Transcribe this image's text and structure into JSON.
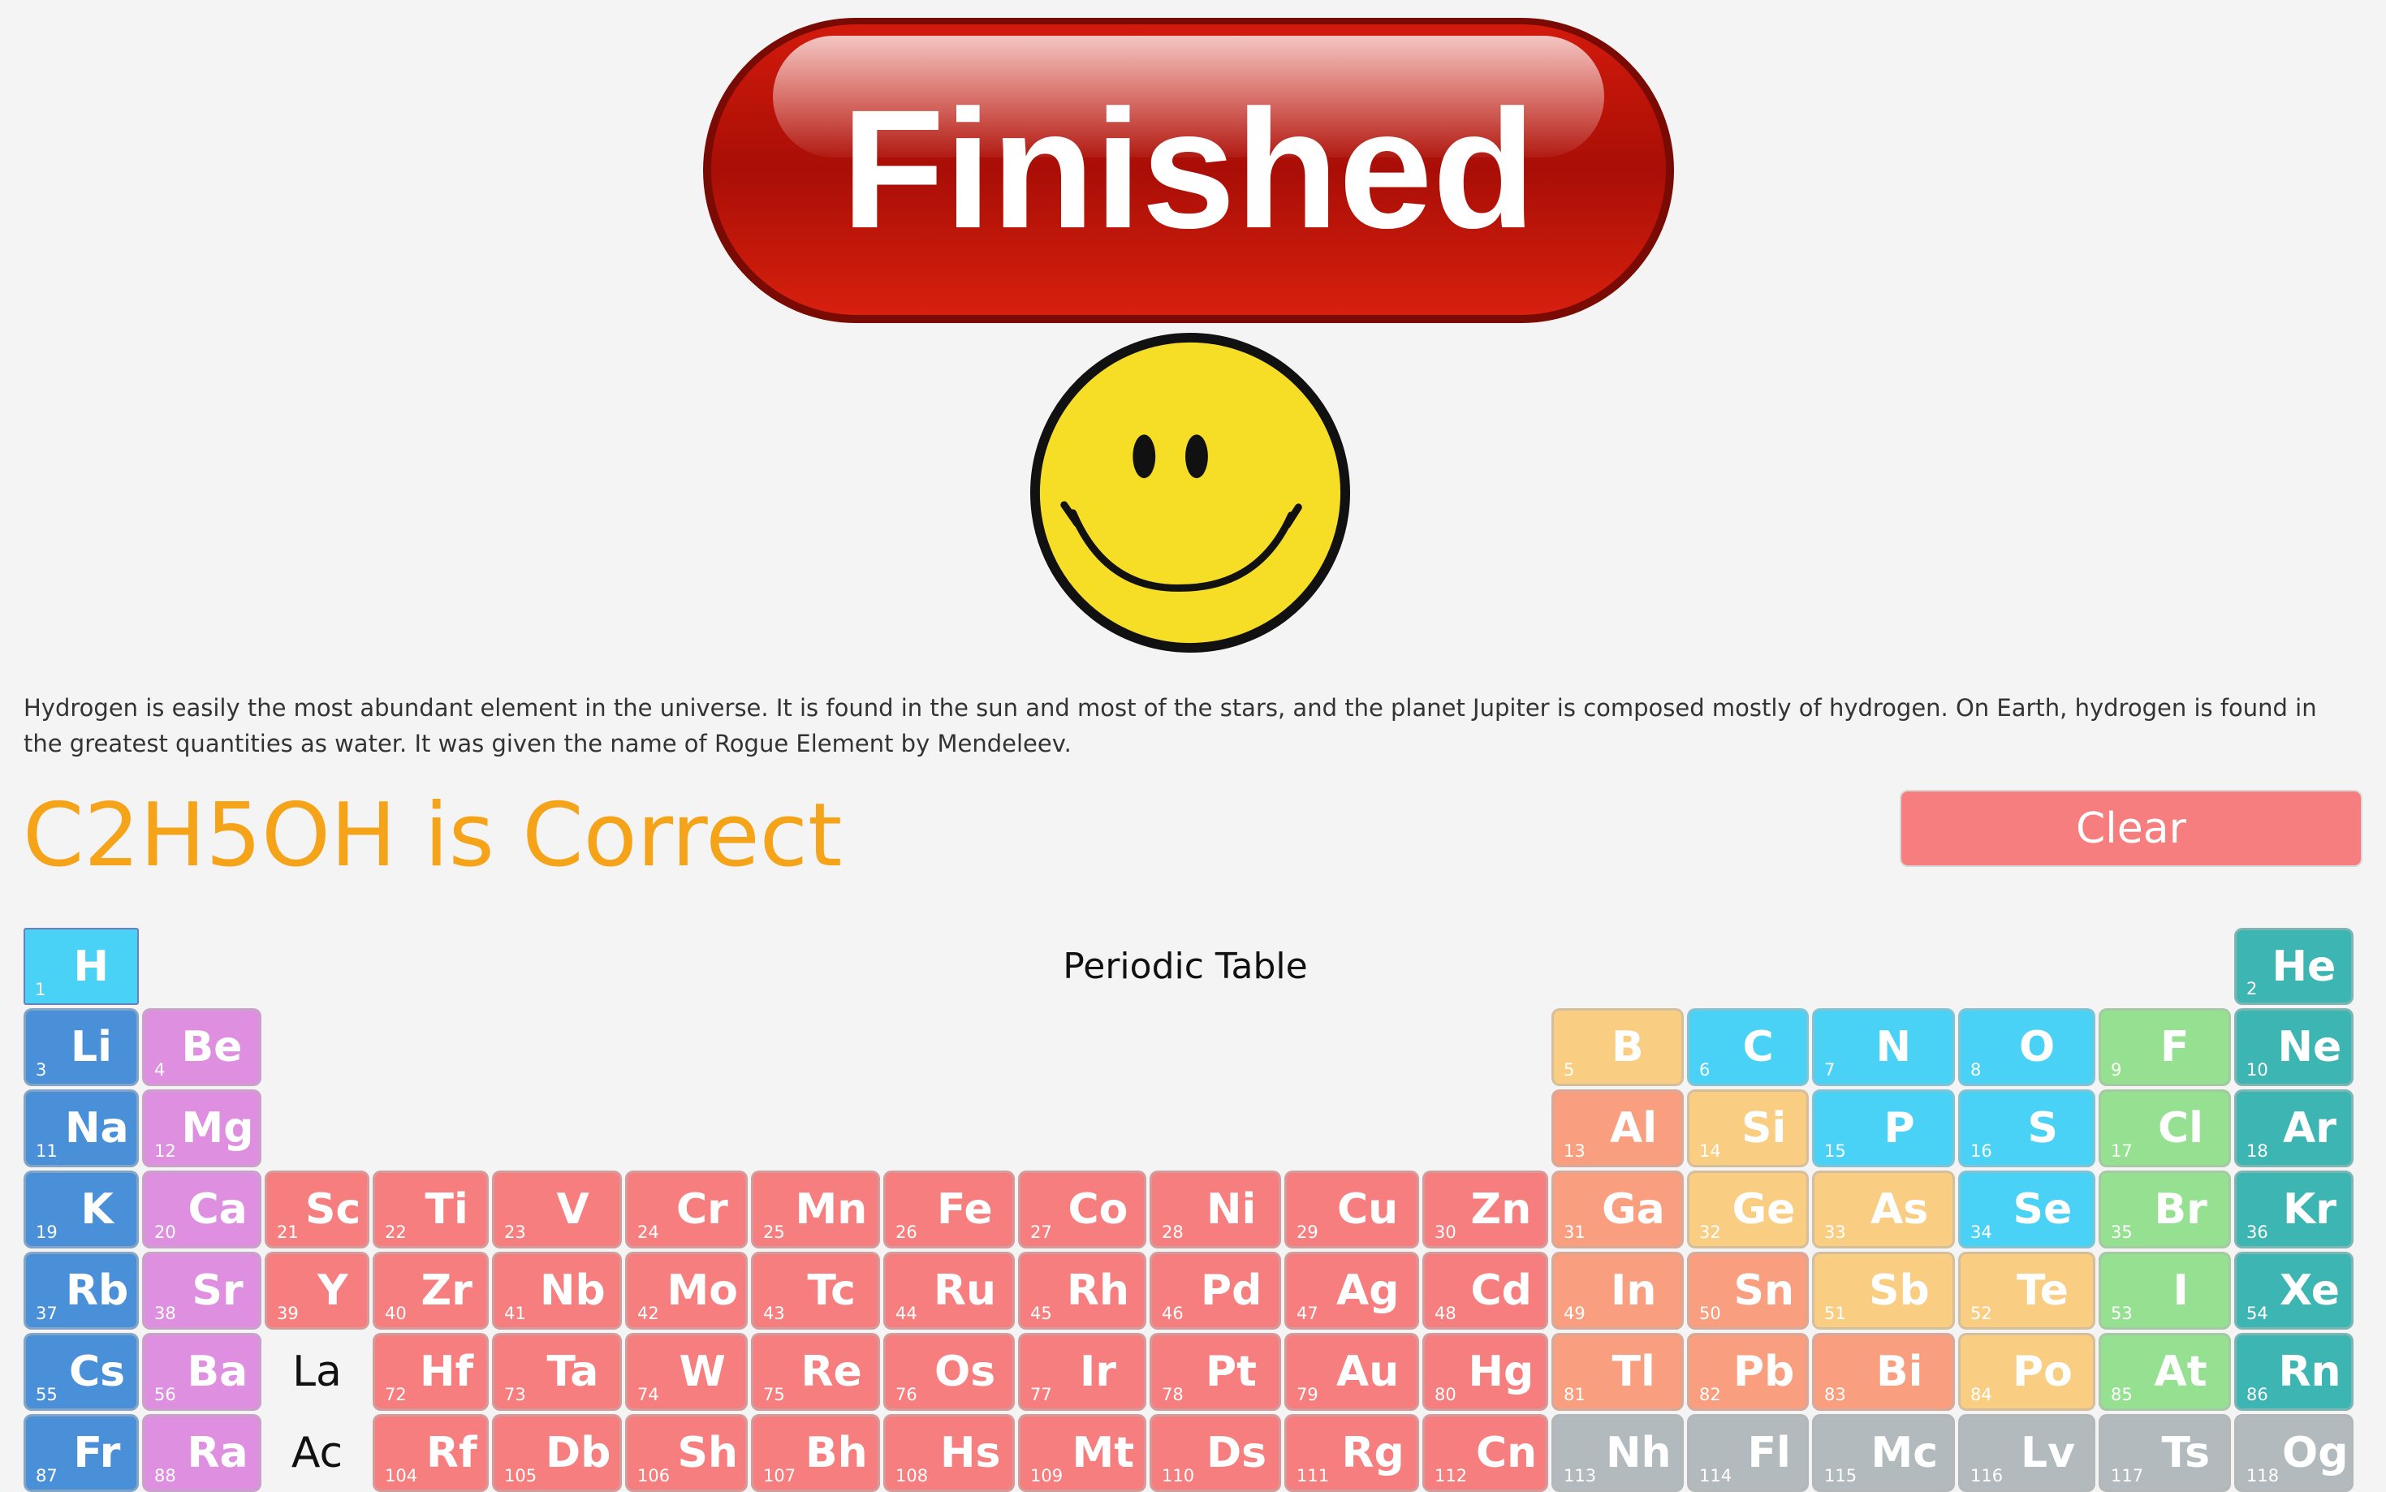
{
  "banner": {
    "text": "Finished"
  },
  "fact_text": "Hydrogen is easily the most abundant element in the universe. It is found in the sun and most of the stars, and the planet Jupiter is composed mostly of hydrogen. On Earth, hydrogen is found in the greatest quantities as water. It was given the name of Rogue Element by Mendeleev.",
  "result_text": "C2H5OH is Correct",
  "clear_label": "Clear",
  "table_title": "Periodic Table",
  "colors": {
    "alkali": "#4a90d9",
    "alkaline": "#de8fdf",
    "transition": "#f77e7e",
    "post": "#f99e7e",
    "metalloid": "#f9cd82",
    "nonmetal": "#49d2f5",
    "halogen": "#96e091",
    "noble": "#3db5b2",
    "unknown": "#b2babd",
    "result": "#f5a318",
    "clear": "#f77e7e"
  },
  "elements": [
    {
      "n": "1",
      "s": "H",
      "row": 0,
      "col": 0,
      "c": "nonmetal",
      "selected": true
    },
    {
      "n": "2",
      "s": "He",
      "row": 0,
      "col": 17,
      "c": "noble"
    },
    {
      "n": "3",
      "s": "Li",
      "row": 1,
      "col": 0,
      "c": "alkali"
    },
    {
      "n": "4",
      "s": "Be",
      "row": 1,
      "col": 1,
      "c": "alkaline"
    },
    {
      "n": "5",
      "s": "B",
      "row": 1,
      "col": 12,
      "c": "metalloid"
    },
    {
      "n": "6",
      "s": "C",
      "row": 1,
      "col": 13,
      "c": "nonmetal"
    },
    {
      "n": "7",
      "s": "N",
      "row": 1,
      "col": 14,
      "c": "nonmetal"
    },
    {
      "n": "8",
      "s": "O",
      "row": 1,
      "col": 15,
      "c": "nonmetal"
    },
    {
      "n": "9",
      "s": "F",
      "row": 1,
      "col": 16,
      "c": "halogen"
    },
    {
      "n": "10",
      "s": "Ne",
      "row": 1,
      "col": 17,
      "c": "noble"
    },
    {
      "n": "11",
      "s": "Na",
      "row": 2,
      "col": 0,
      "c": "alkali"
    },
    {
      "n": "12",
      "s": "Mg",
      "row": 2,
      "col": 1,
      "c": "alkaline"
    },
    {
      "n": "13",
      "s": "Al",
      "row": 2,
      "col": 12,
      "c": "post"
    },
    {
      "n": "14",
      "s": "Si",
      "row": 2,
      "col": 13,
      "c": "metalloid"
    },
    {
      "n": "15",
      "s": "P",
      "row": 2,
      "col": 14,
      "c": "nonmetal"
    },
    {
      "n": "16",
      "s": "S",
      "row": 2,
      "col": 15,
      "c": "nonmetal"
    },
    {
      "n": "17",
      "s": "Cl",
      "row": 2,
      "col": 16,
      "c": "halogen"
    },
    {
      "n": "18",
      "s": "Ar",
      "row": 2,
      "col": 17,
      "c": "noble"
    },
    {
      "n": "19",
      "s": "K",
      "row": 3,
      "col": 0,
      "c": "alkali"
    },
    {
      "n": "20",
      "s": "Ca",
      "row": 3,
      "col": 1,
      "c": "alkaline"
    },
    {
      "n": "21",
      "s": "Sc",
      "row": 3,
      "col": 2,
      "c": "transition"
    },
    {
      "n": "22",
      "s": "Ti",
      "row": 3,
      "col": 3,
      "c": "transition"
    },
    {
      "n": "23",
      "s": "V",
      "row": 3,
      "col": 4,
      "c": "transition"
    },
    {
      "n": "24",
      "s": "Cr",
      "row": 3,
      "col": 5,
      "c": "transition"
    },
    {
      "n": "25",
      "s": "Mn",
      "row": 3,
      "col": 6,
      "c": "transition"
    },
    {
      "n": "26",
      "s": "Fe",
      "row": 3,
      "col": 7,
      "c": "transition"
    },
    {
      "n": "27",
      "s": "Co",
      "row": 3,
      "col": 8,
      "c": "transition"
    },
    {
      "n": "28",
      "s": "Ni",
      "row": 3,
      "col": 9,
      "c": "transition"
    },
    {
      "n": "29",
      "s": "Cu",
      "row": 3,
      "col": 10,
      "c": "transition"
    },
    {
      "n": "30",
      "s": "Zn",
      "row": 3,
      "col": 11,
      "c": "transition"
    },
    {
      "n": "31",
      "s": "Ga",
      "row": 3,
      "col": 12,
      "c": "post"
    },
    {
      "n": "32",
      "s": "Ge",
      "row": 3,
      "col": 13,
      "c": "metalloid"
    },
    {
      "n": "33",
      "s": "As",
      "row": 3,
      "col": 14,
      "c": "metalloid"
    },
    {
      "n": "34",
      "s": "Se",
      "row": 3,
      "col": 15,
      "c": "nonmetal"
    },
    {
      "n": "35",
      "s": "Br",
      "row": 3,
      "col": 16,
      "c": "halogen"
    },
    {
      "n": "36",
      "s": "Kr",
      "row": 3,
      "col": 17,
      "c": "noble"
    },
    {
      "n": "37",
      "s": "Rb",
      "row": 4,
      "col": 0,
      "c": "alkali"
    },
    {
      "n": "38",
      "s": "Sr",
      "row": 4,
      "col": 1,
      "c": "alkaline"
    },
    {
      "n": "39",
      "s": "Y",
      "row": 4,
      "col": 2,
      "c": "transition"
    },
    {
      "n": "40",
      "s": "Zr",
      "row": 4,
      "col": 3,
      "c": "transition"
    },
    {
      "n": "41",
      "s": "Nb",
      "row": 4,
      "col": 4,
      "c": "transition"
    },
    {
      "n": "42",
      "s": "Mo",
      "row": 4,
      "col": 5,
      "c": "transition"
    },
    {
      "n": "43",
      "s": "Tc",
      "row": 4,
      "col": 6,
      "c": "transition"
    },
    {
      "n": "44",
      "s": "Ru",
      "row": 4,
      "col": 7,
      "c": "transition"
    },
    {
      "n": "45",
      "s": "Rh",
      "row": 4,
      "col": 8,
      "c": "transition"
    },
    {
      "n": "46",
      "s": "Pd",
      "row": 4,
      "col": 9,
      "c": "transition"
    },
    {
      "n": "47",
      "s": "Ag",
      "row": 4,
      "col": 10,
      "c": "transition"
    },
    {
      "n": "48",
      "s": "Cd",
      "row": 4,
      "col": 11,
      "c": "transition"
    },
    {
      "n": "49",
      "s": "In",
      "row": 4,
      "col": 12,
      "c": "post"
    },
    {
      "n": "50",
      "s": "Sn",
      "row": 4,
      "col": 13,
      "c": "post"
    },
    {
      "n": "51",
      "s": "Sb",
      "row": 4,
      "col": 14,
      "c": "metalloid"
    },
    {
      "n": "52",
      "s": "Te",
      "row": 4,
      "col": 15,
      "c": "metalloid"
    },
    {
      "n": "53",
      "s": "I",
      "row": 4,
      "col": 16,
      "c": "halogen"
    },
    {
      "n": "54",
      "s": "Xe",
      "row": 4,
      "col": 17,
      "c": "noble"
    },
    {
      "n": "55",
      "s": "Cs",
      "row": 5,
      "col": 0,
      "c": "alkali"
    },
    {
      "n": "56",
      "s": "Ba",
      "row": 5,
      "col": 1,
      "c": "alkaline"
    },
    {
      "n": "72",
      "s": "Hf",
      "row": 5,
      "col": 3,
      "c": "transition"
    },
    {
      "n": "73",
      "s": "Ta",
      "row": 5,
      "col": 4,
      "c": "transition"
    },
    {
      "n": "74",
      "s": "W",
      "row": 5,
      "col": 5,
      "c": "transition"
    },
    {
      "n": "75",
      "s": "Re",
      "row": 5,
      "col": 6,
      "c": "transition"
    },
    {
      "n": "76",
      "s": "Os",
      "row": 5,
      "col": 7,
      "c": "transition"
    },
    {
      "n": "77",
      "s": "Ir",
      "row": 5,
      "col": 8,
      "c": "transition"
    },
    {
      "n": "78",
      "s": "Pt",
      "row": 5,
      "col": 9,
      "c": "transition"
    },
    {
      "n": "79",
      "s": "Au",
      "row": 5,
      "col": 10,
      "c": "transition"
    },
    {
      "n": "80",
      "s": "Hg",
      "row": 5,
      "col": 11,
      "c": "transition"
    },
    {
      "n": "81",
      "s": "Tl",
      "row": 5,
      "col": 12,
      "c": "post"
    },
    {
      "n": "82",
      "s": "Pb",
      "row": 5,
      "col": 13,
      "c": "post"
    },
    {
      "n": "83",
      "s": "Bi",
      "row": 5,
      "col": 14,
      "c": "post"
    },
    {
      "n": "84",
      "s": "Po",
      "row": 5,
      "col": 15,
      "c": "metalloid"
    },
    {
      "n": "85",
      "s": "At",
      "row": 5,
      "col": 16,
      "c": "halogen"
    },
    {
      "n": "86",
      "s": "Rn",
      "row": 5,
      "col": 17,
      "c": "noble"
    },
    {
      "n": "87",
      "s": "Fr",
      "row": 6,
      "col": 0,
      "c": "alkali"
    },
    {
      "n": "88",
      "s": "Ra",
      "row": 6,
      "col": 1,
      "c": "alkaline"
    },
    {
      "n": "104",
      "s": "Rf",
      "row": 6,
      "col": 3,
      "c": "transition"
    },
    {
      "n": "105",
      "s": "Db",
      "row": 6,
      "col": 4,
      "c": "transition"
    },
    {
      "n": "106",
      "s": "Sh",
      "row": 6,
      "col": 5,
      "c": "transition"
    },
    {
      "n": "107",
      "s": "Bh",
      "row": 6,
      "col": 6,
      "c": "transition"
    },
    {
      "n": "108",
      "s": "Hs",
      "row": 6,
      "col": 7,
      "c": "transition"
    },
    {
      "n": "109",
      "s": "Mt",
      "row": 6,
      "col": 8,
      "c": "transition"
    },
    {
      "n": "110",
      "s": "Ds",
      "row": 6,
      "col": 9,
      "c": "transition"
    },
    {
      "n": "111",
      "s": "Rg",
      "row": 6,
      "col": 10,
      "c": "transition"
    },
    {
      "n": "112",
      "s": "Cn",
      "row": 6,
      "col": 11,
      "c": "transition"
    },
    {
      "n": "113",
      "s": "Nh",
      "row": 6,
      "col": 12,
      "c": "unknown"
    },
    {
      "n": "114",
      "s": "Fl",
      "row": 6,
      "col": 13,
      "c": "unknown"
    },
    {
      "n": "115",
      "s": "Mc",
      "row": 6,
      "col": 14,
      "c": "unknown"
    },
    {
      "n": "116",
      "s": "Lv",
      "row": 6,
      "col": 15,
      "c": "unknown"
    },
    {
      "n": "117",
      "s": "Ts",
      "row": 6,
      "col": 16,
      "c": "unknown"
    },
    {
      "n": "118",
      "s": "Og",
      "row": 6,
      "col": 17,
      "c": "unknown"
    }
  ],
  "placeholders": [
    {
      "s": "La",
      "row": 5,
      "col": 2
    },
    {
      "s": "Ac",
      "row": 6,
      "col": 2
    }
  ]
}
